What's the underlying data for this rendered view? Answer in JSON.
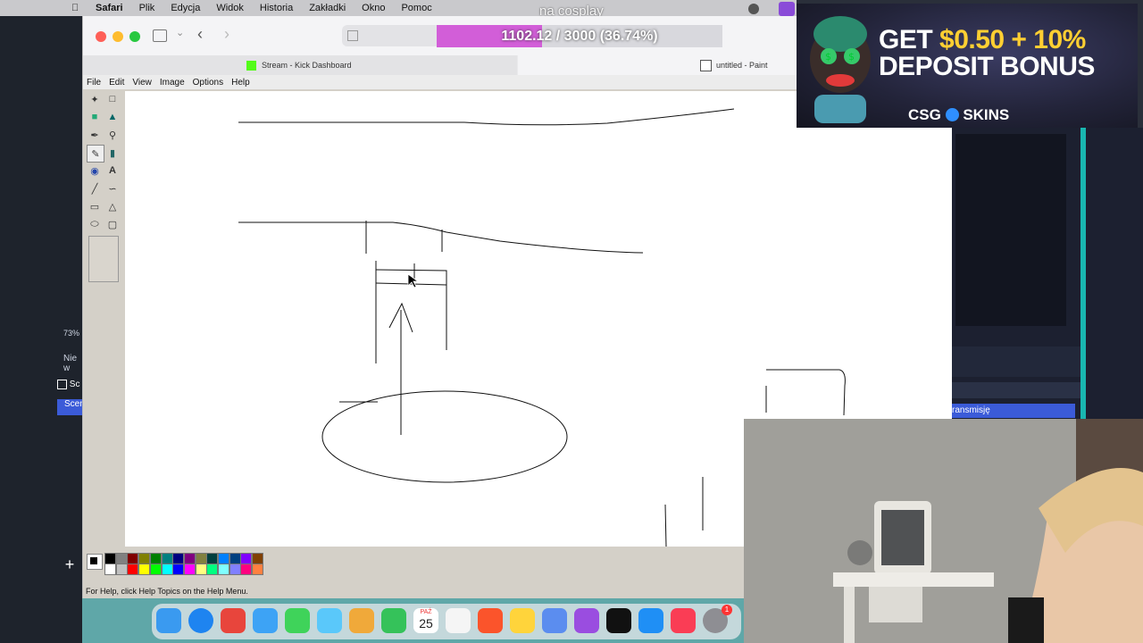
{
  "menubar": {
    "app": "Safari",
    "items": [
      "Plik",
      "Edycja",
      "Widok",
      "Historia",
      "Zakładki",
      "Okno",
      "Pomoc"
    ],
    "overlay_text": "na cosplay"
  },
  "progress": {
    "text": "1102.12 / 3000 (36.74%)",
    "fraction": 0.3674,
    "color": "#d25ed8"
  },
  "tabs": [
    {
      "label": "Stream - Kick Dashboard",
      "icon": "kick-icon"
    },
    {
      "label": "untitled - Paint",
      "icon": "paint-icon"
    }
  ],
  "paint": {
    "menu": [
      "File",
      "Edit",
      "View",
      "Image",
      "Options",
      "Help"
    ],
    "status": "For Help, click Help Topics on the Help Menu.",
    "palette_top": [
      "#000000",
      "#808080",
      "#800000",
      "#808000",
      "#008000",
      "#008080",
      "#000080",
      "#800080",
      "#808040",
      "#004040",
      "#0080ff",
      "#004080",
      "#8000ff",
      "#804000"
    ],
    "palette_bottom": [
      "#ffffff",
      "#c0c0c0",
      "#ff0000",
      "#ffff00",
      "#00ff00",
      "#00ffff",
      "#0000ff",
      "#ff00ff",
      "#ffff80",
      "#00ff80",
      "#80ffff",
      "#8080ff",
      "#ff0080",
      "#ff8040"
    ]
  },
  "left_strip": {
    "zoom": "73%",
    "text1": "Nie w",
    "text2": "Sc",
    "text3": "Scen"
  },
  "right_panel": {
    "button_text": "ransmisję"
  },
  "ad": {
    "line1_a": "GET ",
    "line1_b": "$0.50 + 10%",
    "line2": "DEPOSIT BONUS",
    "logo": "CSG",
    "logo2": "SKINS"
  },
  "dock": {
    "calendar_month": "PAŹ",
    "calendar_day": "25",
    "badge": "1"
  }
}
